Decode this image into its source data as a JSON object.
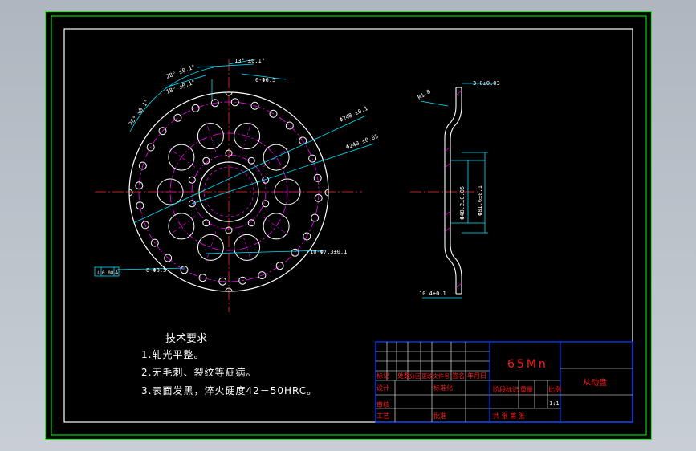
{
  "drawing": {
    "part_name": "从动盘",
    "material": "65Mn",
    "technical_requirements": {
      "title": "技术要求",
      "items": [
        "1.轧光平整。",
        "2.无毛刺、裂纹等疵病。",
        "3.表面发黑，淬火硬度42－50HRC。"
      ]
    },
    "dimensions": {
      "angle_top": "13° ±0.1°",
      "angle_1": "28° ±0.1°",
      "angle_2": "18° ±0.1°",
      "angle_3": "26° ±0.1°",
      "holes_top": "6-Φ6.5",
      "dia_1": "Φ248 ±0.1",
      "dia_2": "Φ240 ±0.05",
      "holes_lower": "10-Φ7.3±0.1",
      "holes_left": "8-Φ8.5",
      "section_thickness": "3.0±0.03",
      "section_r": "R1.8",
      "section_d1": "Φ48.2±0.05",
      "section_d2": "Φ81.6±0.1",
      "section_w": "10.4±0.1",
      "flatness_box": [
        "⊥",
        "0.08",
        "A"
      ]
    },
    "title_block": {
      "row_labels": [
        "标记",
        "处数",
        "分区",
        "更改文件号",
        "签名",
        "年月日"
      ],
      "design": "设计",
      "standardize": "标准化",
      "review": "审核",
      "process": "工艺",
      "approve": "批准",
      "stage_label": "阶段标记",
      "weight_label": "重量",
      "scale_label": "比例",
      "scale_value": "1:1",
      "sheet_label": "共 张 第 张"
    }
  }
}
